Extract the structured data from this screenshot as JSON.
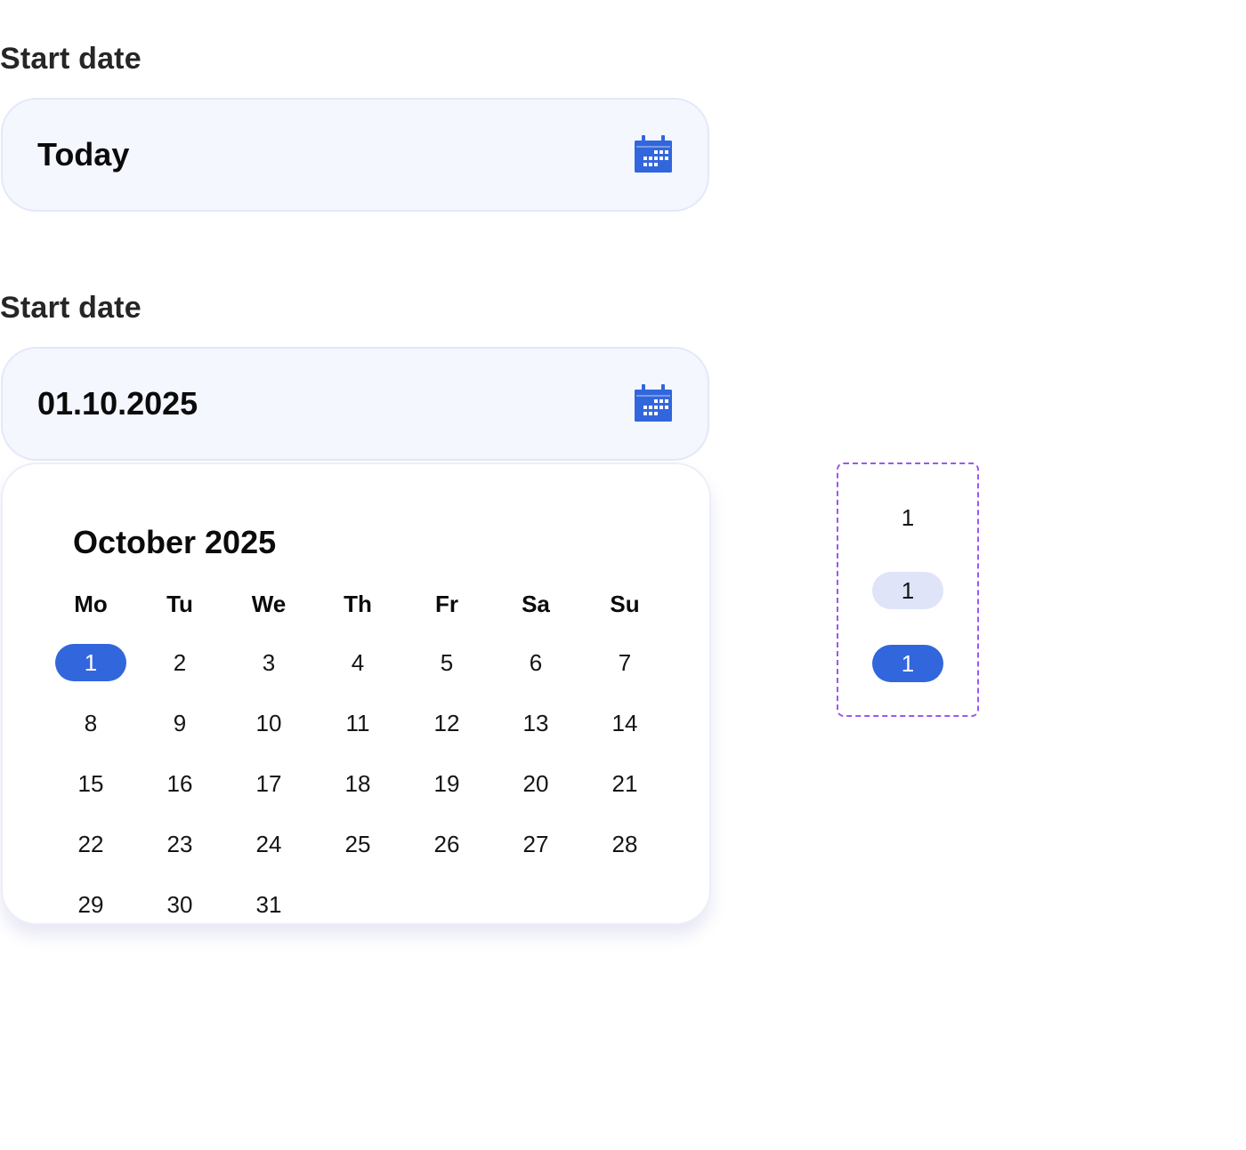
{
  "field1": {
    "label": "Start date",
    "value": "Today",
    "icon": "calendar-icon"
  },
  "field2": {
    "label": "Start date",
    "value": "01.10.2025",
    "icon": "calendar-icon"
  },
  "calendar": {
    "month_title": "October 2025",
    "weekdays": [
      "Mo",
      "Tu",
      "We",
      "Th",
      "Fr",
      "Sa",
      "Su"
    ],
    "weeks": [
      [
        "1",
        "2",
        "3",
        "4",
        "5",
        "6",
        "7"
      ],
      [
        "8",
        "9",
        "10",
        "11",
        "12",
        "13",
        "14"
      ],
      [
        "15",
        "16",
        "17",
        "18",
        "19",
        "20",
        "21"
      ],
      [
        "22",
        "23",
        "24",
        "25",
        "26",
        "27",
        "28"
      ],
      [
        "29",
        "30",
        "31",
        "",
        "",
        "",
        ""
      ]
    ],
    "selected_day": "1"
  },
  "day_states": {
    "default": "1",
    "hover": "1",
    "selected": "1"
  },
  "colors": {
    "accent": "#3266dc",
    "hover_bg": "#dfe4f8",
    "field_bg": "#f4f7fe",
    "field_border": "#e4e8f7",
    "spec_border": "#9b57f2"
  }
}
